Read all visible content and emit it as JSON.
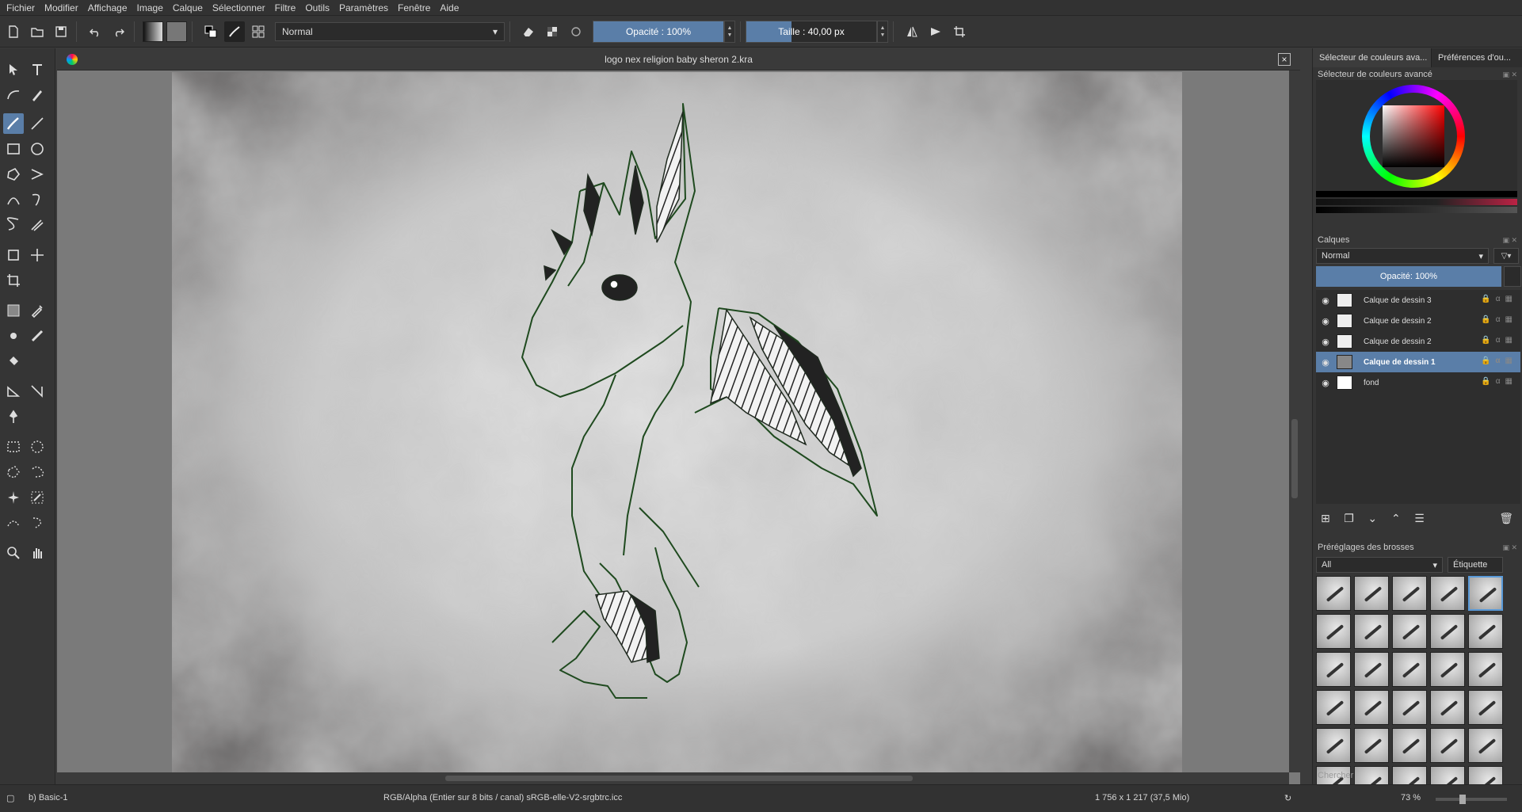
{
  "menu": [
    "Fichier",
    "Modifier",
    "Affichage",
    "Image",
    "Calque",
    "Sélectionner",
    "Filtre",
    "Outils",
    "Paramètres",
    "Fenêtre",
    "Aide"
  ],
  "toolbar": {
    "blend_mode": "Normal",
    "opacity_label": "Opacité : 100%",
    "opacity_value": 100,
    "size_label_prefix": "Taille :",
    "size_value": "40,00 px",
    "size_fill_fraction": 0.35
  },
  "document": {
    "title": "logo nex religion baby sheron 2.kra",
    "close_symbol": "×"
  },
  "rightdock": {
    "tabs": [
      "Sélecteur de couleurs ava...",
      "Préférences d'ou..."
    ],
    "color_panel_title": "Sélecteur de couleurs avancé",
    "layers_title": "Calques",
    "layers_blend": "Normal",
    "layers_opacity": "Opacité: 100%",
    "layers": [
      {
        "name": "Calque de dessin 3",
        "active": false
      },
      {
        "name": "Calque de dessin 2",
        "active": false
      },
      {
        "name": "Calque de dessin 2",
        "active": false
      },
      {
        "name": "Calque de dessin 1",
        "active": true
      },
      {
        "name": "fond",
        "active": false
      }
    ],
    "brushes_title": "Préréglages des brosses",
    "brushes_filter": "All",
    "brushes_tag": "Étiquette",
    "search_placeholder": "Chercher"
  },
  "status": {
    "brush": "b) Basic-1",
    "color_profile": "RGB/Alpha (Entier sur 8 bits / canal)  sRGB-elle-V2-srgbtrc.icc",
    "image_size": "1 756 x 1 217 (37,5 Mio)",
    "zoom": "73 %"
  },
  "colors": {
    "accent": "#5a7ea8",
    "line_art": "#1f4a1f"
  }
}
